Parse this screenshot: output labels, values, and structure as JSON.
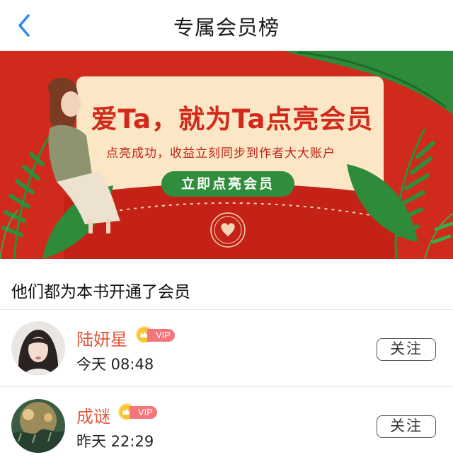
{
  "navbar": {
    "title": "专属会员榜",
    "back_icon": "chevron-left-icon",
    "accent": "#2a8cf0"
  },
  "banner": {
    "headline": "爱Ta，就为Ta点亮会员",
    "subline": "点亮成功，收益立刻同步到作者大大账户",
    "cta_label": "立即点亮会员",
    "colors": {
      "background": "#d02a1c",
      "card": "#fbe6c6",
      "cta": "#2f8e3b"
    }
  },
  "section": {
    "title": "他们都为本书开通了会员"
  },
  "members": [
    {
      "name": "陆妍星",
      "badge": "VIP",
      "time": "今天 08:48",
      "follow_label": "关注"
    },
    {
      "name": "成谜",
      "badge": "VIP",
      "time": "昨天 22:29",
      "follow_label": "关注"
    }
  ]
}
